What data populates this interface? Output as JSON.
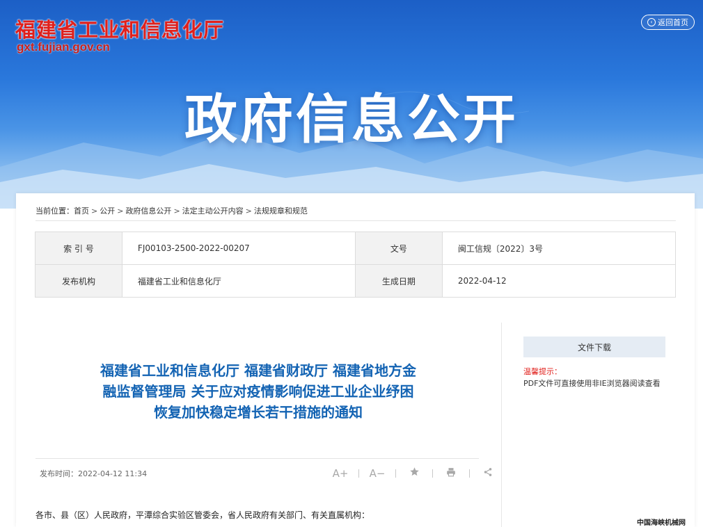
{
  "header": {
    "site_title": "福建省工业和信息化厅",
    "site_url": "gxt.fujian.gov.cn",
    "back_home_label": "返回首页",
    "section_title": "政府信息公开"
  },
  "breadcrumb": {
    "prefix": "当前位置：",
    "items": [
      "首页",
      "公开",
      "政府信息公开",
      "法定主动公开内容",
      "法规规章和规范"
    ],
    "separator": ">"
  },
  "meta_table": {
    "index_label": "索 引 号",
    "index_value": "FJ00103-2500-2022-00207",
    "docno_label": "文号",
    "docno_value": "闽工信规〔2022〕3号",
    "publisher_label": "发布机构",
    "publisher_value": "福建省工业和信息化厅",
    "date_label": "生成日期",
    "date_value": "2022-04-12"
  },
  "article": {
    "title": "福建省工业和信息化厅 福建省财政厅 福建省地方金融监督管理局 关于应对疫情影响促进工业企业纾困恢复加快稳定增长若干措施的通知",
    "publish_time": "发布时间：2022-04-12 11:34",
    "body_first_line": "各市、县（区）人民政府，平潭综合实验区管委会，省人民政府有关部门、有关直属机构："
  },
  "tools": {
    "font_increase": "A+",
    "font_decrease": "A−",
    "favorite_icon": "star-icon",
    "print_icon": "print-icon",
    "share_icon": "share-icon"
  },
  "sidebar": {
    "download_label": "文件下载",
    "tip_label": "温馨提示：",
    "tip_text": "PDF文件可直接使用非IE浏览器阅读查看"
  },
  "watermark": "中国海峡机械网",
  "colors": {
    "banner_blue": "#2a78dc",
    "title_red": "#e0201c",
    "article_title_blue": "#1363b3",
    "label_bg": "#f2f2f2"
  }
}
